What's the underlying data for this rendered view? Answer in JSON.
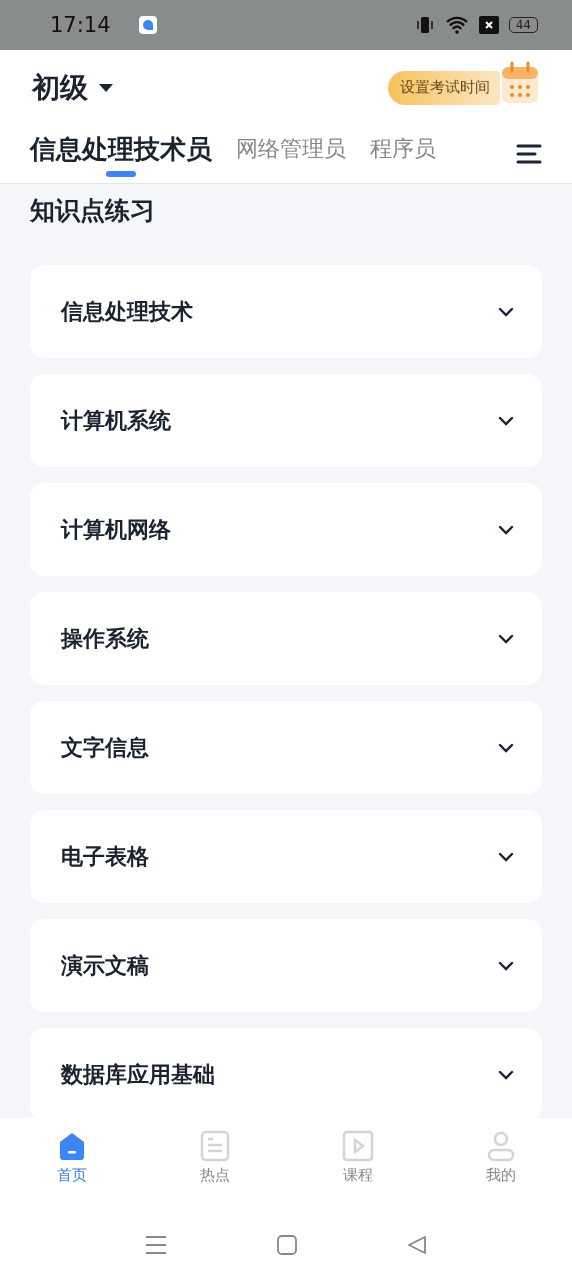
{
  "status_bar": {
    "time": "17:14",
    "battery": "44"
  },
  "header": {
    "level": "初级",
    "exam_button": "设置考试时间"
  },
  "tabs": [
    {
      "label": "信息处理技术员",
      "selected": true
    },
    {
      "label": "网络管理员",
      "selected": false
    },
    {
      "label": "程序员",
      "selected": false
    }
  ],
  "section_title": "知识点练习",
  "topics": [
    {
      "label": "信息处理技术",
      "expanded": false
    },
    {
      "label": "计算机系统",
      "expanded": false
    },
    {
      "label": "计算机网络",
      "expanded": false
    },
    {
      "label": "操作系统",
      "expanded": false
    },
    {
      "label": "文字信息",
      "expanded": false
    },
    {
      "label": "电子表格",
      "expanded": false
    },
    {
      "label": "演示文稿",
      "expanded": false
    },
    {
      "label": "数据库应用基础",
      "expanded": false
    }
  ],
  "bottom_nav": [
    {
      "label": "首页",
      "kind": "home",
      "selected": true
    },
    {
      "label": "热点",
      "kind": "doc",
      "selected": false
    },
    {
      "label": "课程",
      "kind": "play",
      "selected": false
    },
    {
      "label": "我的",
      "kind": "user",
      "selected": false
    }
  ]
}
